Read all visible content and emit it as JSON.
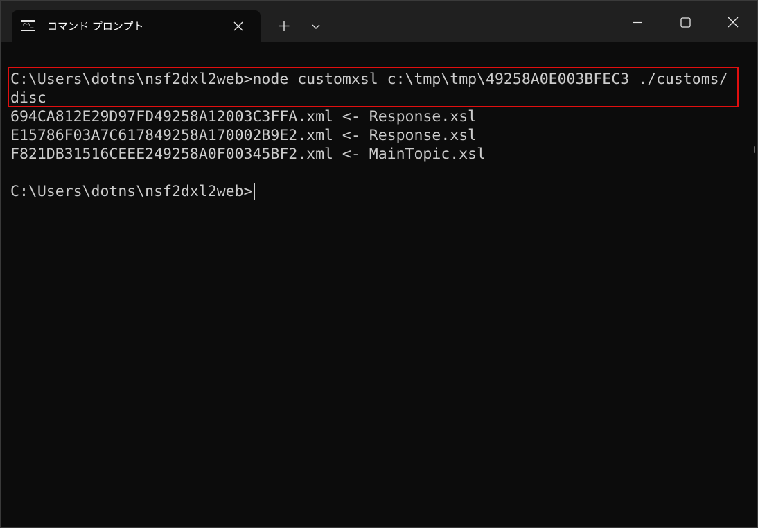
{
  "window": {
    "tab_title": "コマンド プロンプト",
    "icon": "command-prompt-icon",
    "tab_icon_text": "C:\\_"
  },
  "controls": {
    "new_tab_icon": "plus-icon",
    "dropdown_icon": "chevron-down-icon",
    "minimize_icon": "minimize-icon",
    "maximize_icon": "maximize-icon",
    "close_icon": "close-icon"
  },
  "terminal": {
    "lines": [
      "C:\\Users\\dotns\\nsf2dxl2web>node customxsl c:\\tmp\\tmp\\49258A0E003BFEC3 ./customs/",
      "disc",
      "694CA812E29D97FD49258A12003C3FFA.xml <- Response.xsl",
      "E15786F03A7C617849258A170002B9E2.xml <- Response.xsl",
      "F821DB31516CEEE249258A0F00345BF2.xml <- MainTopic.xsl",
      "",
      "C:\\Users\\dotns\\nsf2dxl2web>"
    ]
  },
  "colors": {
    "terminal_bg": "#0c0c0c",
    "terminal_text": "#cccccc",
    "titlebar_bg": "#202020",
    "highlight": "#e10f0f"
  }
}
